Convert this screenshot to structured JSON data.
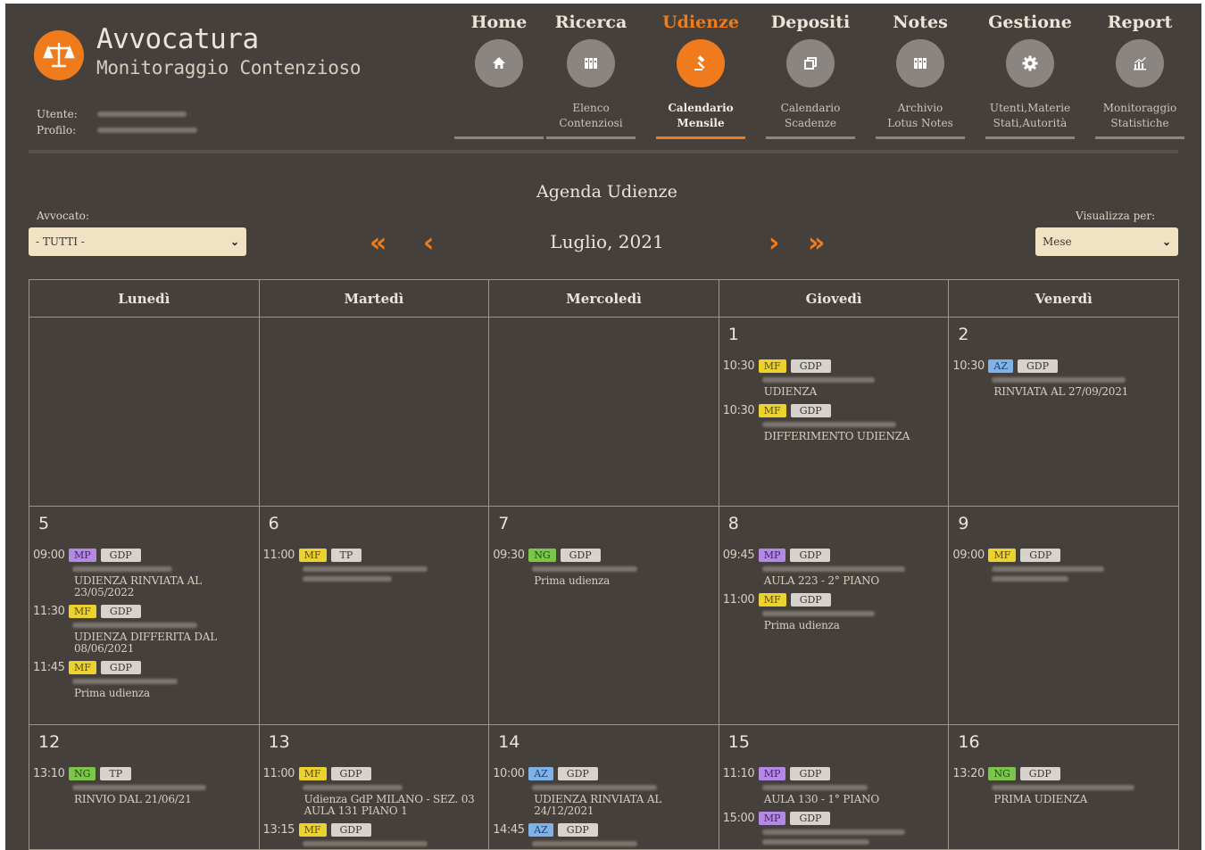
{
  "header": {
    "title": "Avvocatura",
    "subtitle": "Monitoraggio Contenzioso",
    "user_label": "Utente:",
    "profile_label": "Profilo:"
  },
  "nav": [
    {
      "label": "Home",
      "sub1": "",
      "sub2": "",
      "icon": "home-icon",
      "active": false
    },
    {
      "label": "Ricerca",
      "sub1": "Elenco",
      "sub2": "Contenziosi",
      "icon": "binders-icon",
      "active": false
    },
    {
      "label": "Udienze",
      "sub1": "Calendario",
      "sub2": "Mensile",
      "icon": "gavel-icon",
      "active": true
    },
    {
      "label": "Depositi",
      "sub1": "Calendario",
      "sub2": "Scadenze",
      "icon": "copy-icon",
      "active": false
    },
    {
      "label": "Notes",
      "sub1": "Archivio",
      "sub2": "Lotus Notes",
      "icon": "binders-icon",
      "active": false
    },
    {
      "label": "Gestione",
      "sub1": "Utenti,Materie",
      "sub2": "Stati,Autorità",
      "icon": "gear-icon",
      "active": false
    },
    {
      "label": "Report",
      "sub1": "Monitoraggio",
      "sub2": "Statistiche",
      "icon": "chart-icon",
      "active": false
    }
  ],
  "agenda": {
    "title": "Agenda Udienze",
    "month": "Luglio, 2021",
    "lawyer_label": "Avvocato:",
    "lawyer_value": "- TUTTI -",
    "view_label": "Visualizza per:",
    "view_value": "Mese"
  },
  "colors": {
    "accent": "#ef7b1d",
    "background": "#45403b",
    "MF": "#ecd22f",
    "MP": "#b489e6",
    "NG": "#7bc54a",
    "AZ": "#7fb2e8",
    "GDP": "#d7d2cc"
  },
  "calendar": {
    "weekdays": [
      "Lunedì",
      "Martedì",
      "Mercoledì",
      "Giovedì",
      "Venerdì"
    ],
    "weeks": [
      {
        "days": [
          {
            "num": "",
            "events": []
          },
          {
            "num": "",
            "events": []
          },
          {
            "num": "",
            "events": []
          },
          {
            "num": "1",
            "events": [
              {
                "time": "10:30",
                "tag": "MF",
                "type": "GDP",
                "desc": "UDIENZA"
              },
              {
                "time": "10:30",
                "tag": "MF",
                "type": "GDP",
                "desc": "DIFFERIMENTO UDIENZA"
              }
            ]
          },
          {
            "num": "2",
            "events": [
              {
                "time": "10:30",
                "tag": "AZ",
                "type": "GDP",
                "desc": "RINVIATA AL 27/09/2021"
              }
            ]
          }
        ]
      },
      {
        "days": [
          {
            "num": "5",
            "events": [
              {
                "time": "09:00",
                "tag": "MP",
                "type": "GDP",
                "desc": "UDIENZA RINVIATA AL 23/05/2022"
              },
              {
                "time": "11:30",
                "tag": "MF",
                "type": "GDP",
                "desc": "UDIENZA DIFFERITA DAL 08/06/2021"
              },
              {
                "time": "11:45",
                "tag": "MF",
                "type": "GDP",
                "desc": "Prima udienza"
              }
            ]
          },
          {
            "num": "6",
            "events": [
              {
                "time": "11:00",
                "tag": "MF",
                "type": "TP",
                "desc": ""
              }
            ]
          },
          {
            "num": "7",
            "events": [
              {
                "time": "09:30",
                "tag": "NG",
                "type": "GDP",
                "desc": "Prima udienza"
              }
            ]
          },
          {
            "num": "8",
            "events": [
              {
                "time": "09:45",
                "tag": "MP",
                "type": "GDP",
                "desc": "AULA 223 - 2° PIANO"
              },
              {
                "time": "11:00",
                "tag": "MF",
                "type": "GDP",
                "desc": "Prima udienza"
              }
            ]
          },
          {
            "num": "9",
            "events": [
              {
                "time": "09:00",
                "tag": "MF",
                "type": "GDP",
                "desc": ""
              }
            ]
          }
        ]
      },
      {
        "days": [
          {
            "num": "12",
            "events": [
              {
                "time": "13:10",
                "tag": "NG",
                "type": "TP",
                "desc": "RINVIO DAL 21/06/21"
              }
            ]
          },
          {
            "num": "13",
            "events": [
              {
                "time": "11:00",
                "tag": "MF",
                "type": "GDP",
                "desc": "Udienza GdP MILANO - SEZ. 03 AULA 131 PIANO 1"
              },
              {
                "time": "13:15",
                "tag": "MF",
                "type": "GDP",
                "desc": ""
              }
            ]
          },
          {
            "num": "14",
            "events": [
              {
                "time": "10:00",
                "tag": "AZ",
                "type": "GDP",
                "desc": "UDIENZA RINVIATA AL 24/12/2021"
              },
              {
                "time": "14:45",
                "tag": "AZ",
                "type": "GDP",
                "desc": ""
              }
            ]
          },
          {
            "num": "15",
            "events": [
              {
                "time": "11:10",
                "tag": "MP",
                "type": "GDP",
                "desc": "AULA 130 - 1° PIANO"
              },
              {
                "time": "15:00",
                "tag": "MP",
                "type": "GDP",
                "desc": ""
              }
            ]
          },
          {
            "num": "16",
            "events": [
              {
                "time": "13:20",
                "tag": "NG",
                "type": "GDP",
                "desc": "PRIMA UDIENZA"
              }
            ]
          }
        ]
      }
    ]
  }
}
